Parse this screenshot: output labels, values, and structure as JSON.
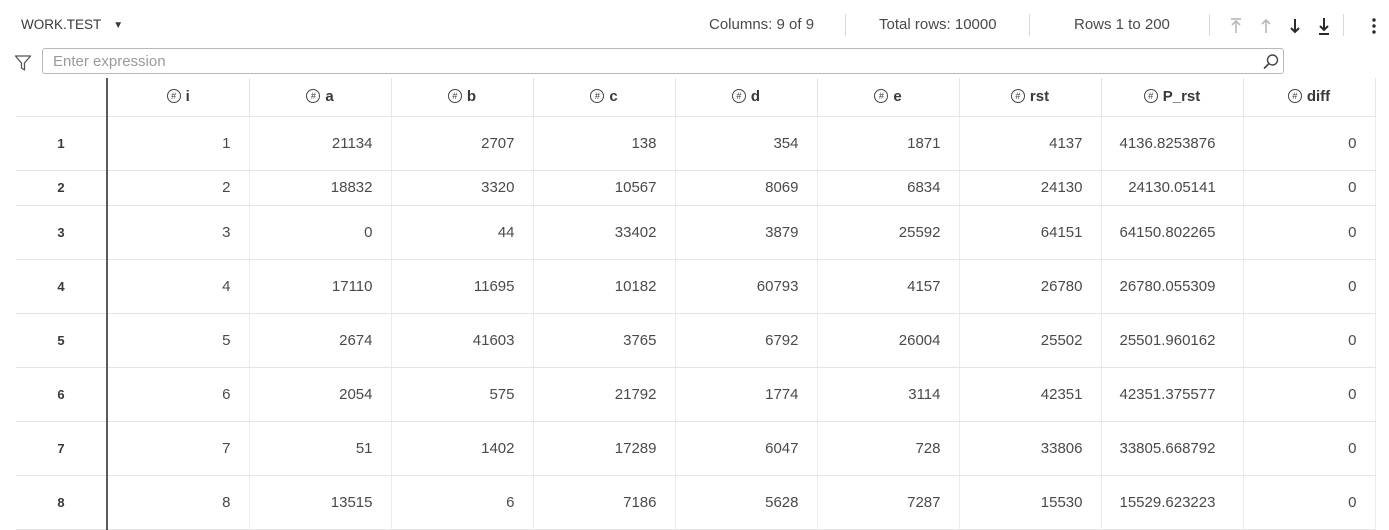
{
  "toolbar": {
    "dataset": "WORK.TEST",
    "columns": "Columns: 9 of 9",
    "total_rows": "Total rows: 10000",
    "rows_range": "Rows 1 to 200",
    "icons": [
      "caret-down-icon",
      "first-page-icon",
      "previous-page-icon",
      "next-page-icon",
      "last-page-icon",
      "more-options-icon"
    ]
  },
  "filter": {
    "placeholder": "Enter expression",
    "value": "",
    "icons": [
      "filter-icon",
      "search-icon"
    ]
  },
  "grid": {
    "column_icon": "numeric-column-icon",
    "columns": [
      "i",
      "a",
      "b",
      "c",
      "d",
      "e",
      "rst",
      "P_rst",
      "diff"
    ],
    "rows": [
      {
        "n": "1",
        "cells": [
          "1",
          "21134",
          "2707",
          "138",
          "354",
          "1871",
          "4137",
          "4136.8253876",
          "0"
        ]
      },
      {
        "n": "2",
        "cells": [
          "2",
          "18832",
          "3320",
          "10567",
          "8069",
          "6834",
          "24130",
          "24130.05141",
          "0"
        ]
      },
      {
        "n": "3",
        "cells": [
          "3",
          "0",
          "44",
          "33402",
          "3879",
          "25592",
          "64151",
          "64150.802265",
          "0"
        ]
      },
      {
        "n": "4",
        "cells": [
          "4",
          "17110",
          "11695",
          "10182",
          "60793",
          "4157",
          "26780",
          "26780.055309",
          "0"
        ]
      },
      {
        "n": "5",
        "cells": [
          "5",
          "2674",
          "41603",
          "3765",
          "6792",
          "26004",
          "25502",
          "25501.960162",
          "0"
        ]
      },
      {
        "n": "6",
        "cells": [
          "6",
          "2054",
          "575",
          "21792",
          "1774",
          "3114",
          "42351",
          "42351.375577",
          "0"
        ]
      },
      {
        "n": "7",
        "cells": [
          "7",
          "51",
          "1402",
          "17289",
          "6047",
          "728",
          "33806",
          "33805.668792",
          "0"
        ]
      },
      {
        "n": "8",
        "cells": [
          "8",
          "13515",
          "6",
          "7186",
          "5628",
          "7287",
          "15530",
          "15529.623223",
          "0"
        ]
      }
    ]
  }
}
